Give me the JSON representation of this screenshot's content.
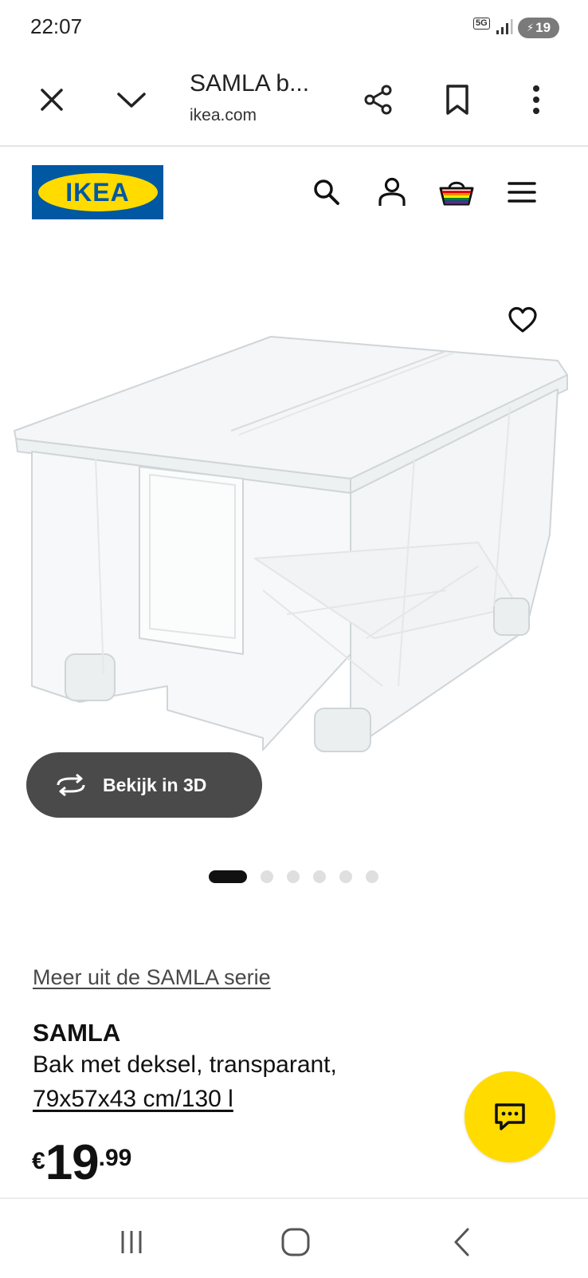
{
  "status_bar": {
    "time": "22:07",
    "network": "5G",
    "battery": "19"
  },
  "browser": {
    "page_title": "SAMLA b...",
    "domain": "ikea.com"
  },
  "ikea_header": {
    "logo_text": "IKEA",
    "icons": [
      "search-icon",
      "account-icon",
      "shopping-bag-icon",
      "menu-icon"
    ],
    "brand_colors": {
      "blue": "#0058a3",
      "yellow": "#ffdb00"
    }
  },
  "product_image": {
    "view_3d_label": "Bekijk in 3D",
    "carousel": {
      "total": 6,
      "active": 1
    }
  },
  "product": {
    "series_link": "Meer uit de SAMLA serie",
    "name": "SAMLA",
    "description": "Bak met deksel, transparant,",
    "size": "79x57x43 cm/130 l",
    "price": {
      "currency": "€",
      "integer": "19",
      "decimals": ".99"
    }
  }
}
